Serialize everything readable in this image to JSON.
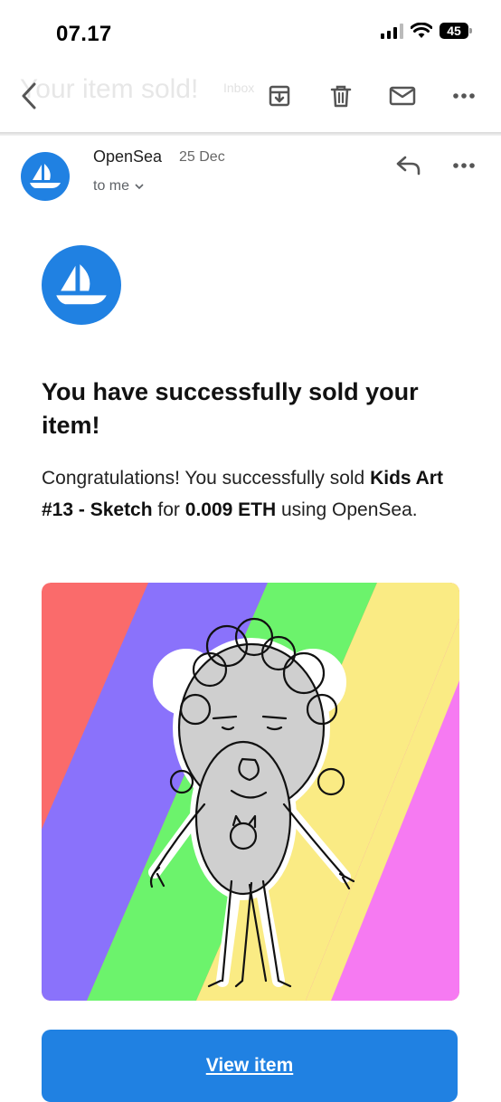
{
  "status_bar": {
    "time": "07.17",
    "battery": "45"
  },
  "toolbar": {
    "subject": "Your item sold!",
    "label": "Inbox"
  },
  "email": {
    "sender": "OpenSea",
    "date": "25 Dec",
    "recipient": "to me"
  },
  "content": {
    "headline": "You have successfully sold your item!",
    "message": {
      "intro": "Congratulations! You successfully sold ",
      "item_name": "Kids Art #13 - Sketch",
      "for_text": " for ",
      "price": "0.009 ETH",
      "outro": " using OpenSea."
    },
    "button_label": "View item"
  },
  "colors": {
    "brand_blue": "#2081e2",
    "stripes": [
      "#fa6b6b",
      "#8a72fb",
      "#6cf36c",
      "#faeb84",
      "#f67af2"
    ]
  },
  "icons": [
    "back-icon",
    "archive-icon",
    "trash-icon",
    "mail-icon",
    "more-icon",
    "reply-icon",
    "chevron-down-icon",
    "opensea-logo"
  ]
}
